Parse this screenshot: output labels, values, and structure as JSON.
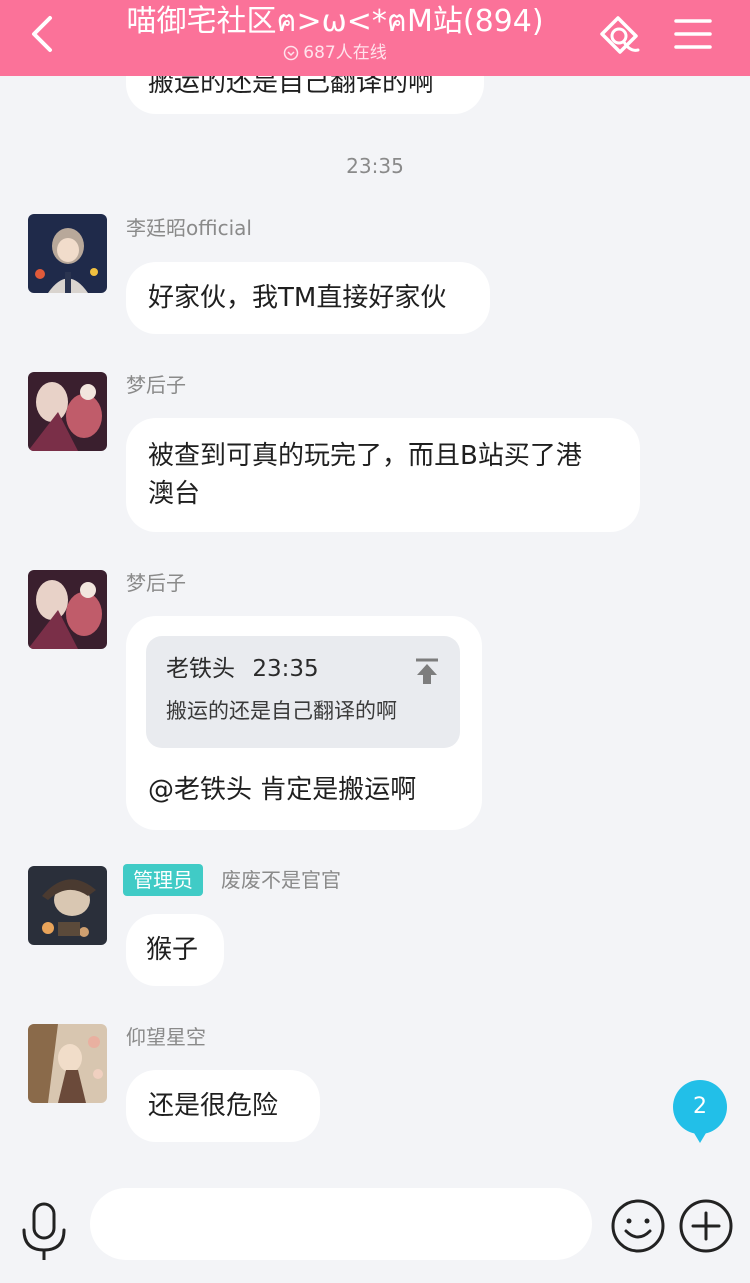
{
  "header": {
    "title": "喵御宅社区ฅ>ω<*ฅM站(894)",
    "online": "687人在线"
  },
  "messages": {
    "partial_text": "搬运的还是自己翻译的啊",
    "timestamp": "23:35",
    "m1": {
      "sender": "李廷昭official",
      "text": "好家伙，我TM直接好家伙"
    },
    "m2": {
      "sender": "梦后子",
      "line1": "被查到可真的玩完了，而且B站买了港",
      "line2": "澳台"
    },
    "m3": {
      "sender": "梦后子",
      "quote_sender": "老铁头",
      "quote_time": "23:35",
      "quote_text": "搬运的还是自己翻译的啊",
      "text": "@老铁头 肯定是搬运啊"
    },
    "m4": {
      "badge": "管理员",
      "sender": "废废不是官官",
      "text": "猴子"
    },
    "m5": {
      "sender": "仰望星空",
      "text": "还是很危险"
    }
  },
  "unread_count": "2",
  "input": {
    "value": "",
    "placeholder": ""
  },
  "colors": {
    "header": "#fb7299",
    "badge": "#40cbc6",
    "unread": "#22bfe8",
    "background": "#f3f4f7"
  },
  "icons": [
    "back-arrow-icon",
    "online-status-icon",
    "ticket-icon",
    "menu-icon",
    "quote-jump-icon",
    "microphone-icon",
    "emoji-icon",
    "plus-icon"
  ]
}
